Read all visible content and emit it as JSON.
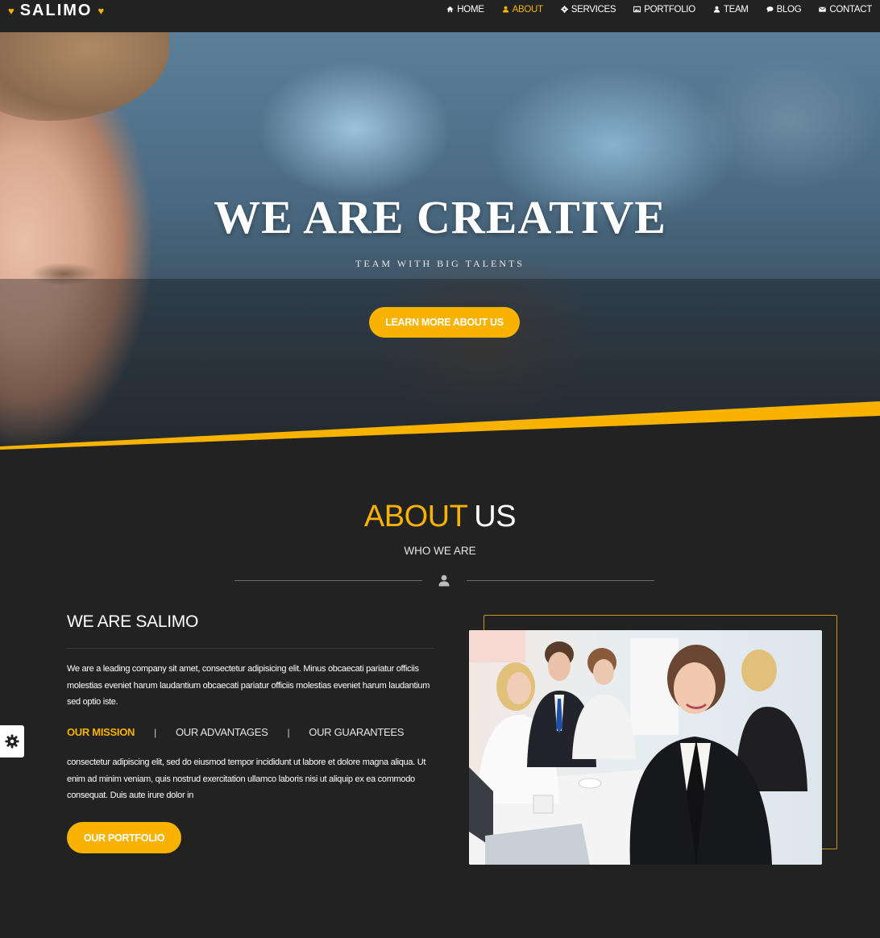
{
  "brand": {
    "name": "SALIMO"
  },
  "nav": {
    "items": [
      {
        "label": "HOME",
        "icon": "home-icon",
        "active": false
      },
      {
        "label": "ABOUT",
        "icon": "user-icon",
        "active": true
      },
      {
        "label": "SERVICES",
        "icon": "gear-icon",
        "active": false
      },
      {
        "label": "PORTFOLIO",
        "icon": "image-icon",
        "active": false
      },
      {
        "label": "TEAM",
        "icon": "user-icon",
        "active": false
      },
      {
        "label": "BLOG",
        "icon": "comment-icon",
        "active": false
      },
      {
        "label": "CONTACT",
        "icon": "envelope-icon",
        "active": false
      }
    ]
  },
  "hero": {
    "title": "WE ARE CREATIVE",
    "subtitle": "TEAM WITH BIG TALENTS",
    "button_label": "LEARN MORE ABOUT US"
  },
  "about": {
    "title_accent": "ABOUT",
    "title_rest": "US",
    "subtitle": "WHO WE ARE",
    "heading": "WE ARE SALIMO",
    "paragraph": "We are a leading company sit amet, consectetur adipisicing elit. Minus obcaecati pariatur officiis molestias eveniet harum laudantium obcaecati pariatur officiis molestias eveniet harum laudantium sed optio iste.",
    "tabs": [
      {
        "label": "OUR MISSION",
        "active": true
      },
      {
        "label": "OUR ADVANTAGES",
        "active": false
      },
      {
        "label": "OUR GUARANTEES",
        "active": false
      }
    ],
    "tab_content": "consectetur adipiscing elit, sed do eiusmod tempor incididunt ut labore et dolore magna aliqua. Ut enim ad minim veniam, quis nostrud exercitation ullamco laboris nisi ut aliquip ex ea commodo consequat. Duis aute irure dolor in",
    "button_label": "OUR PORTFOLIO"
  },
  "colors": {
    "accent": "#f8b200",
    "background": "#222222",
    "text": "#ffffff"
  }
}
